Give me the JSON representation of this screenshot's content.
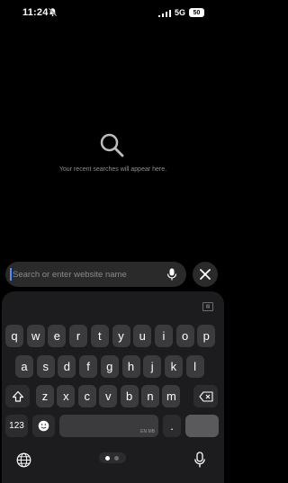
{
  "status_bar": {
    "time": "11:24",
    "network": "5G",
    "battery": "50"
  },
  "empty_state": {
    "message": "Your recent searches will appear here."
  },
  "search": {
    "placeholder": "Search or enter website name"
  },
  "keyboard": {
    "row1": [
      "q",
      "w",
      "e",
      "r",
      "t",
      "y",
      "u",
      "i",
      "o",
      "p"
    ],
    "row2": [
      "a",
      "s",
      "d",
      "f",
      "g",
      "h",
      "j",
      "k",
      "l"
    ],
    "row3": [
      "z",
      "x",
      "c",
      "v",
      "b",
      "n",
      "m"
    ],
    "numbers_key": "123",
    "period_key": ".",
    "space_hint": "EN MB"
  },
  "page_indicator": {
    "total": 2,
    "active": 1
  },
  "colors": {
    "accent": "#4a90ff",
    "key": "#3b3b3d",
    "keyboard_bg": "#1c1c1e"
  }
}
